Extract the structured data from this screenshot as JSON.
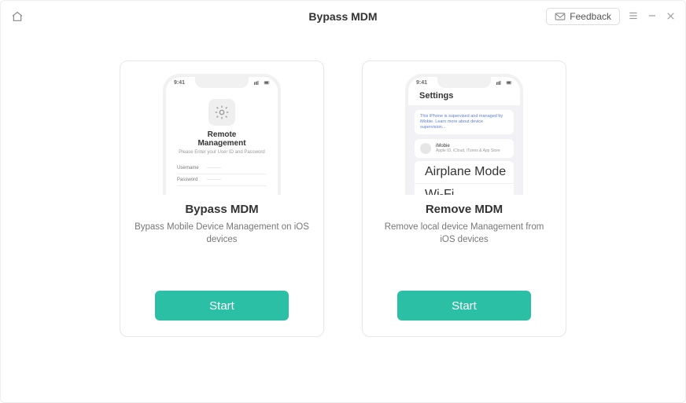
{
  "titlebar": {
    "title": "Bypass MDM",
    "feedback_label": "Feedback"
  },
  "cards": {
    "bypass": {
      "title": "Bypass MDM",
      "description": "Bypass Mobile Device Management on iOS devices",
      "button": "Start",
      "phone": {
        "time": "9:41",
        "heading_line1": "Remote",
        "heading_line2": "Management",
        "subtext": "Please Enter your User ID and Password",
        "username_label": "Username",
        "password_label": "Password"
      }
    },
    "remove": {
      "title": "Remove MDM",
      "description": "Remove local device Management from iOS devices",
      "button": "Start",
      "phone": {
        "time": "9:41",
        "settings_title": "Settings",
        "banner": "This iPhone is supervised and managed by iMobie. Learn more about device supervision...",
        "profile_name": "iMobie",
        "profile_sub": "Apple ID, iCloud, iTunes & App Store",
        "airplane": "Airplane Mode",
        "wifi": "Wi-Fi"
      }
    }
  }
}
